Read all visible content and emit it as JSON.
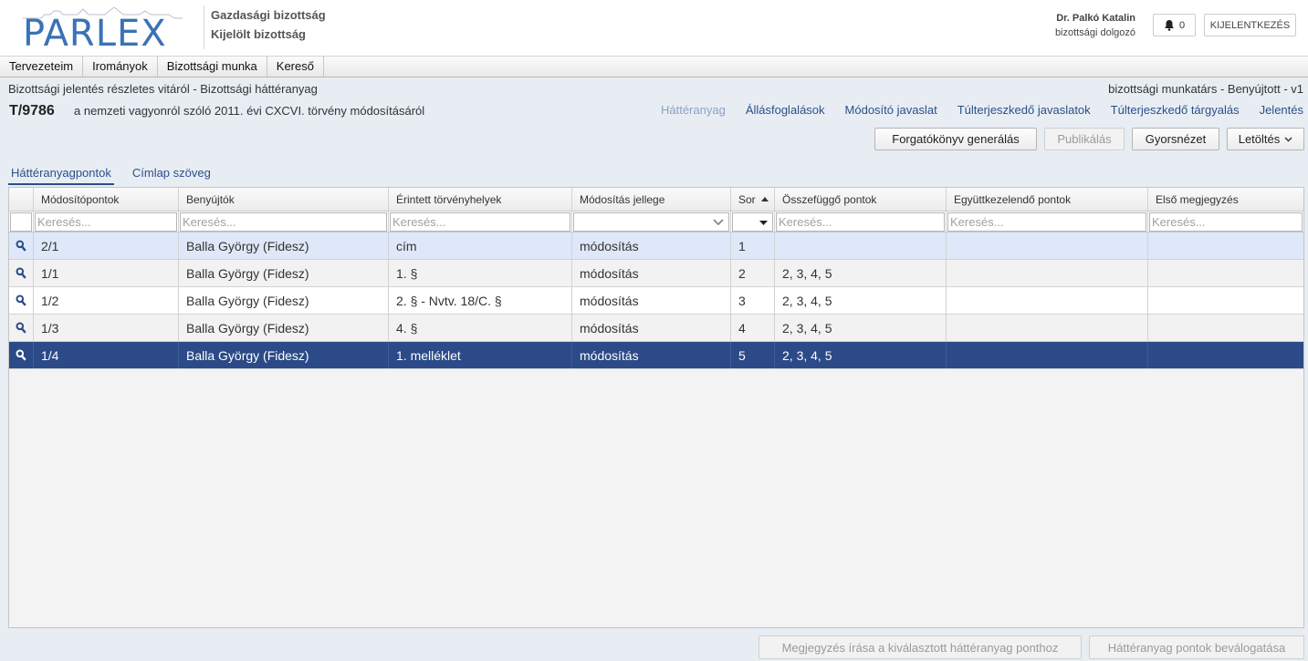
{
  "header": {
    "logo_text": "PARLEX",
    "committee_1": "Gazdasági bizottság",
    "committee_2": "Kijelölt bizottság",
    "user_name": "Dr. Palkó Katalin",
    "user_role": "bizottsági dolgozó",
    "notification_count": "0",
    "logout_label": "KIJELENTKEZÉS"
  },
  "menu": {
    "items": [
      "Tervezeteim",
      "Irományok",
      "Bizottsági munka",
      "Kereső"
    ]
  },
  "document": {
    "subtitle": "Bizottsági jelentés részletes vitáról - Bizottsági háttéranyag",
    "status": "bizottsági munkatárs - Benyújtott - v1",
    "code": "T/9786",
    "title": "a nemzeti vagyonról szóló 2011. évi CXCVI. törvény módosításáról"
  },
  "navlinks": [
    "Háttéranyag",
    "Állásfoglalások",
    "Módosító javaslat",
    "Túlterjeszkedő javaslatok",
    "Túlterjeszkedő tárgyalás",
    "Jelentés"
  ],
  "toolbar": {
    "script_button": "Forgatókönyv generálás",
    "publish_button": "Publikálás",
    "preview_button": "Gyorsnézet",
    "download_button": "Letöltés"
  },
  "tabs": [
    "Háttéranyagpontok",
    "Címlap szöveg"
  ],
  "grid": {
    "columns": [
      "Módosítópontok",
      "Benyújtók",
      "Érintett törvényhelyek",
      "Módosítás jellege",
      "Sor",
      "Összefüggő pontok",
      "Együttkezelendő pontok",
      "Első megjegyzés"
    ],
    "filter_placeholder": "Keresés...",
    "rows": [
      [
        "2/1",
        "Balla György (Fidesz)",
        "cím",
        "módosítás",
        "1",
        "",
        "",
        ""
      ],
      [
        "1/1",
        "Balla György (Fidesz)",
        "1. §",
        "módosítás",
        "2",
        "2, 3, 4, 5",
        "",
        ""
      ],
      [
        "1/2",
        "Balla György (Fidesz)",
        "2. § - Nvtv. 18/C. §",
        "módosítás",
        "3",
        "2, 3, 4, 5",
        "",
        ""
      ],
      [
        "1/3",
        "Balla György (Fidesz)",
        "4. §",
        "módosítás",
        "4",
        "2, 3, 4, 5",
        "",
        ""
      ],
      [
        "1/4",
        "Balla György (Fidesz)",
        "1. melléklet",
        "módosítás",
        "5",
        "2, 3, 4, 5",
        "",
        ""
      ]
    ]
  },
  "footer": {
    "comment_button": "Megjegyzés írása a kiválasztott háttéranyag ponthoz",
    "select_button": "Háttéranyag pontok beválogatása"
  },
  "colors": {
    "brand_blue": "#3a72b5",
    "selected_row": "#2b4a87",
    "hover_row": "#dfe8f8",
    "link": "#2c4f8a"
  }
}
